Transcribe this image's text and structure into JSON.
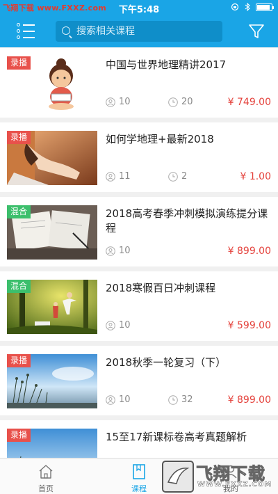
{
  "status_bar": {
    "watermark": "飞翔下载 www.FXXZ.com",
    "time": "下午5:48",
    "battery_level": 0.9
  },
  "header": {
    "search_placeholder": "搜索相关课程",
    "menu_icon": "list-menu-icon",
    "filter_icon": "funnel-filter-icon"
  },
  "courses": [
    {
      "badge": "录播",
      "title": "中国与世界地理精讲2017",
      "students": "10",
      "lessons": "20",
      "price": "¥ 749.00"
    },
    {
      "badge": "录播",
      "title": "如何学地理+最新2018",
      "students": "11",
      "lessons": "2",
      "price": "¥ 1.00"
    },
    {
      "badge": "混合",
      "title": "2018高考春季冲刺模拟演练提分课程",
      "students": "10",
      "lessons": "",
      "price": "¥ 899.00"
    },
    {
      "badge": "混合",
      "title": "2018寒假百日冲刺课程",
      "students": "10",
      "lessons": "",
      "price": "¥ 599.00"
    },
    {
      "badge": "录播",
      "title": "2018秋季一轮复习（下）",
      "students": "10",
      "lessons": "32",
      "price": "¥ 899.00"
    },
    {
      "badge": "录播",
      "title": "15至17新课标卷高考真题解析",
      "students": "",
      "lessons": "",
      "price": ""
    }
  ],
  "tabbar": {
    "home": "首页",
    "courses": "课程",
    "mine": "我的"
  },
  "watermark_logo": {
    "brand": "飞翔下载",
    "url": "WWW.FXXZ.COM"
  },
  "colors": {
    "primary": "#1aa5e6",
    "price": "#e4413b",
    "badge_recorded": "#e8514b",
    "badge_mixed": "#3cbf6c"
  }
}
